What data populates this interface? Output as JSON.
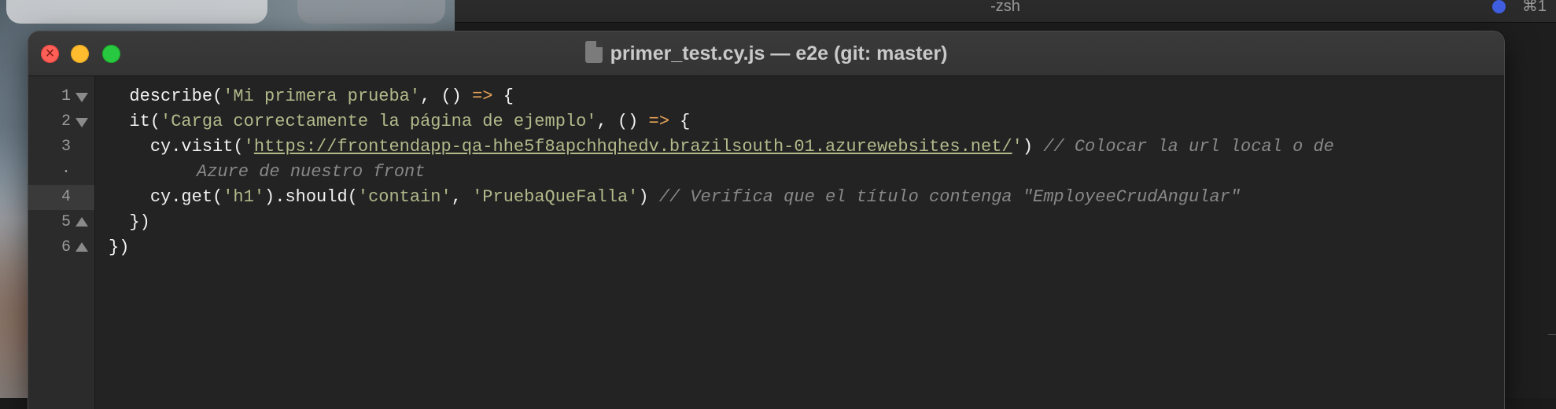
{
  "background_terminal": {
    "title": "-zsh",
    "shortcut": "⌘1"
  },
  "window": {
    "title": "primer_test.cy.js — e2e (git: master)"
  },
  "gutter": {
    "rows": [
      {
        "num": "1",
        "fold": "down"
      },
      {
        "num": "2",
        "fold": "down"
      },
      {
        "num": "3",
        "fold": ""
      },
      {
        "num": "·",
        "fold": ""
      },
      {
        "num": "4",
        "fold": ""
      },
      {
        "num": "5",
        "fold": "up"
      },
      {
        "num": "6",
        "fold": "up"
      }
    ]
  },
  "code": {
    "l1": {
      "a": "describe(",
      "s": "'Mi primera prueba'",
      "b": ", () ",
      "arrow": "=>",
      "c": " {"
    },
    "l2": {
      "a": "it(",
      "s": "'Carga correctamente la página de ejemplo'",
      "b": ", () ",
      "arrow": "=>",
      "c": " {"
    },
    "l3": {
      "a": "cy.visit(",
      "q1": "'",
      "url": "https://frontendapp-qa-hhe5f8apchhqhedv.brazilsouth-01.azurewebsites.net/",
      "q2": "'",
      "b": ") ",
      "comment": "// Colocar la url local o de"
    },
    "l3b": {
      "comment": "Azure de nuestro front"
    },
    "l4": {
      "a": "cy.get(",
      "s1": "'h1'",
      "b": ").should(",
      "s2": "'contain'",
      "c": ", ",
      "s3": "'PruebaQueFalla'",
      "d": ") ",
      "comment": "// Verifica que el título contenga \"EmployeeCrudAngular\""
    },
    "l5": {
      "text": "})"
    },
    "l6": {
      "text": "})"
    }
  }
}
